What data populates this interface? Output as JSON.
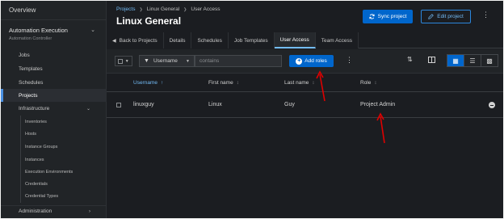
{
  "sidebar": {
    "overview": "Overview",
    "automation_title": "Automation Execution",
    "automation_subtitle": "Automation Controller",
    "links": [
      "Jobs",
      "Templates",
      "Schedules",
      "Projects"
    ],
    "infrastructure": "Infrastructure",
    "infra_items": [
      "Inventories",
      "Hosts",
      "Instance Groups",
      "Instances",
      "Execution Environments",
      "Credentials",
      "Credential Types"
    ],
    "administration": "Administration"
  },
  "header": {
    "breadcrumb": [
      "Projects",
      "Linux General",
      "User Access"
    ],
    "title": "Linux General",
    "sync_label": "Sync project",
    "edit_label": "Edit project"
  },
  "tabs": [
    "Back to Projects",
    "Details",
    "Schedules",
    "Job Templates",
    "User Access",
    "Team Access"
  ],
  "toolbar": {
    "filter_field": "Username",
    "filter_placeholder": "contains",
    "add_label": "Add roles"
  },
  "table": {
    "headers": [
      "Username",
      "First name",
      "Last name",
      "Role"
    ],
    "rows": [
      {
        "username": "linuxguy",
        "first_name": "Linux",
        "last_name": "Guy",
        "role": "Project Admin"
      }
    ]
  },
  "colors": {
    "primary": "#0066cc",
    "link": "#73bcf7",
    "annotation": "#e00000"
  }
}
